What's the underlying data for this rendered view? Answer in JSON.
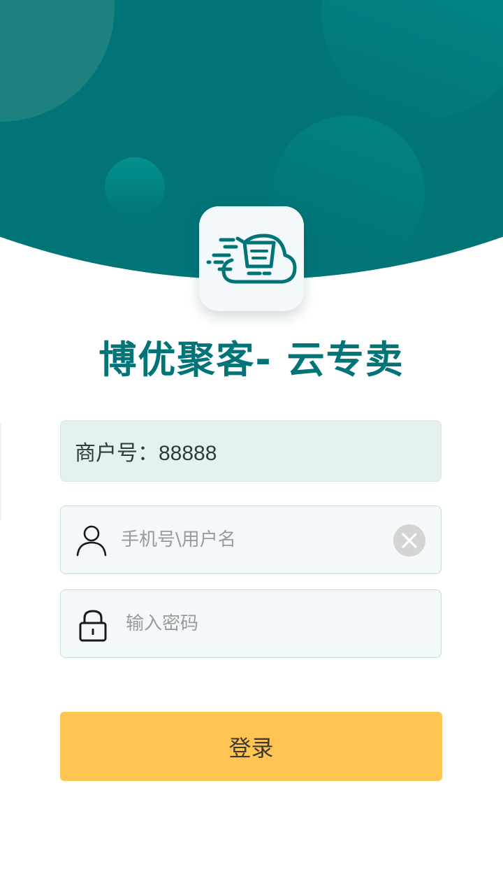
{
  "app": {
    "title": "博优聚客- 云专卖"
  },
  "merchant": {
    "text": "商户号：88888"
  },
  "login_form": {
    "username_placeholder": "手机号\\用户名",
    "username_value": "",
    "password_placeholder": "输入密码",
    "password_value": "",
    "submit_label": "登录"
  },
  "icons": {
    "logo": "cloud-shopping-cart-icon",
    "user": "user-icon",
    "lock": "lock-icon",
    "clear": "close-icon"
  },
  "colors": {
    "brand": "#017478",
    "button": "#ffc552",
    "merchant_bg": "#e4f1f0",
    "input_bg": "#f3f8fa"
  }
}
